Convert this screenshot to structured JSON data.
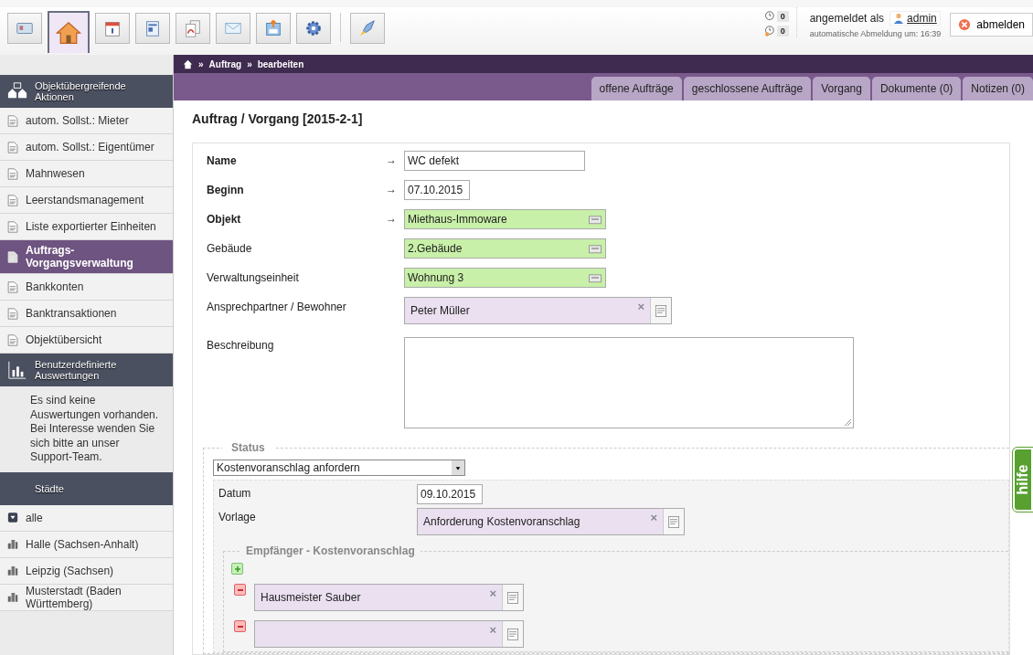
{
  "toolbar": {
    "buttons": [
      {
        "selected": false
      },
      {
        "selected": true
      },
      {
        "selected": false
      },
      {
        "selected": false
      },
      {
        "selected": false
      },
      {
        "selected": false
      },
      {
        "selected": false
      },
      {
        "selected": false
      },
      {
        "selected": false
      }
    ],
    "counters": [
      {
        "value": "0"
      },
      {
        "value": "0"
      }
    ],
    "user": {
      "label": "angemeldet als",
      "name": "admin",
      "auto_logout": "automatische Abmeldung um: 16:39"
    },
    "logout": "abmelden"
  },
  "breadcrumb": {
    "separator": "»",
    "items": [
      "Auftrag",
      "bearbeiten"
    ]
  },
  "tabs": [
    {
      "label": "offene Aufträge",
      "selected": false
    },
    {
      "label": "geschlossene Aufträge",
      "selected": false
    },
    {
      "label": "Vorgang",
      "selected": false
    },
    {
      "label": "Dokumente (0)",
      "selected": false
    },
    {
      "label": "Notizen (0)",
      "selected": false
    }
  ],
  "sidebar": [
    {
      "kind": "header",
      "label": "Objektübergreifende Aktionen"
    },
    {
      "kind": "page",
      "label": "autom. Sollst.: Mieter",
      "selected": false
    },
    {
      "kind": "page",
      "label": "autom. Sollst.: Eigentümer",
      "selected": false
    },
    {
      "kind": "page",
      "label": "Mahnwesen",
      "selected": false
    },
    {
      "kind": "page",
      "label": "Leerstandsmanagement",
      "selected": false
    },
    {
      "kind": "page",
      "label": "Liste exportierter Einheiten",
      "selected": false
    },
    {
      "kind": "page",
      "label": "Auftrags-Vorgangsverwaltung",
      "selected": true
    },
    {
      "kind": "page",
      "label": "Bankkonten",
      "selected": false
    },
    {
      "kind": "page",
      "label": "Banktransaktionen",
      "selected": false
    },
    {
      "kind": "page",
      "label": "Objektübersicht",
      "selected": false
    },
    {
      "kind": "header",
      "label": "Benutzerdefinierte Auswertungen"
    },
    {
      "kind": "text",
      "label": "Es sind keine Auswertungen vorhanden. Bei Interesse wenden Sie sich bitte an unser Support-Team."
    },
    {
      "kind": "header",
      "label": "Städte"
    },
    {
      "kind": "toggle",
      "label": "alle",
      "selected": false
    },
    {
      "kind": "city",
      "label": "Halle (Sachsen-Anhalt)",
      "selected": false
    },
    {
      "kind": "city",
      "label": "Leipzig (Sachsen)",
      "selected": false
    },
    {
      "kind": "city",
      "label": "Musterstadt (Baden Württemberg)",
      "selected": false
    }
  ],
  "form": {
    "title": "Auftrag / Vorgang [2015-2-1]",
    "arrow": "→",
    "fields": [
      {
        "kind": "text",
        "label": "Name",
        "required": true,
        "value": "WC defekt"
      },
      {
        "kind": "date",
        "label": "Beginn",
        "required": true,
        "value": "07.10.2015"
      },
      {
        "kind": "lookup",
        "label": "Objekt",
        "required": true,
        "value": "Miethaus-Immoware"
      },
      {
        "kind": "lookup",
        "label": "Gebäude",
        "required": false,
        "value": "2.Gebäude"
      },
      {
        "kind": "lookup",
        "label": "Verwaltungseinheit",
        "required": false,
        "value": "Wohnung 3"
      },
      {
        "kind": "person",
        "label": "Ansprechpartner / Bewohner",
        "required": false,
        "value": "Peter Müller",
        "clear": "×"
      },
      {
        "kind": "textarea",
        "label": "Beschreibung",
        "required": false
      }
    ],
    "status": {
      "legend": "Status",
      "select": "Kostenvoranschlag anfordern",
      "date_label": "Datum",
      "date": "09.10.2015",
      "template_label": "Vorlage",
      "template": "Anforderung Kostenvoranschlag",
      "clear": "×",
      "recipients": {
        "legend": "Empfänger - Kostenvoranschlag",
        "items": [
          {
            "value": "Hausmeister Sauber",
            "clear": "×"
          },
          {
            "clear": "×"
          }
        ]
      }
    }
  },
  "help": "hilfe"
}
